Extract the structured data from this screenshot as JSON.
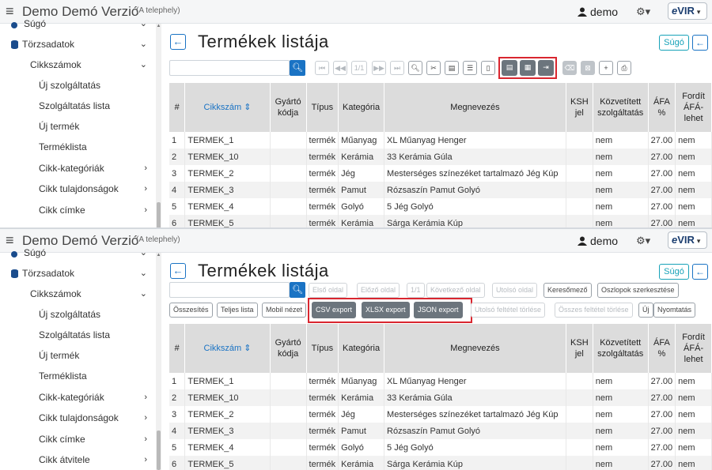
{
  "app": {
    "title": "Demo Demó Verzió",
    "site_note": "(A telephely)",
    "user": "demo",
    "logo": "VIR",
    "menu_icon": "hamburger-icon",
    "gear_icon": "gear-icon"
  },
  "sidebar": {
    "partial_item": "Súgó",
    "section": "Törzsadatok",
    "group": "Cikkszámok",
    "items": [
      "Új szolgáltatás",
      "Szolgáltatás lista",
      "Új termék",
      "Terméklista"
    ],
    "submenus": [
      "Cikk-kategóriák",
      "Cikk tulajdonságok",
      "Cikk címke",
      "Cikk átvitele"
    ]
  },
  "page": {
    "title": "Termékek listája",
    "help": "Súgó"
  },
  "toolbar_labels": {
    "page_indicator": "1/1",
    "first": "Első oldal",
    "prev": "Előző oldal",
    "next": "Következő oldal",
    "last": "Utolsó oldal",
    "search_field": "Keresőmező",
    "edit_columns": "Oszlopok szerkesztése",
    "summary": "Összesítés",
    "full_list": "Teljes lista",
    "mobile_view": "Mobil nézet",
    "csv_export": "CSV export",
    "xlsx_export": "XLSX export",
    "json_export": "JSON export",
    "clear_last_filter": "Utolsó feltétel törlése",
    "clear_all_filters": "Összes feltétel törlése",
    "new": "Új",
    "print": "Nyomtatás"
  },
  "table": {
    "headers": {
      "num": "#",
      "sku": "Cikkszám",
      "mfr_code_1": "Gyártó",
      "mfr_code_2": "kódja",
      "type": "Típus",
      "category": "Kategória",
      "name": "Megnevezés",
      "ksh_1": "KSH",
      "ksh_2": "jel",
      "mediated_1": "Közvetített",
      "mediated_2": "szolgáltatás",
      "vat_1": "ÁFA",
      "vat_2": "%",
      "reverse_1": "Fordít",
      "reverse_2": "ÁFÁ-",
      "reverse_3": "lehet"
    },
    "rows": [
      {
        "n": "1",
        "sku": "TERMEK_1",
        "type": "termék",
        "cat": "Műanyag",
        "name": "XL Műanyag Henger",
        "mediated": "nem",
        "vat": "27.00",
        "rev": "nem"
      },
      {
        "n": "2",
        "sku": "TERMEK_10",
        "type": "termék",
        "cat": "Kerámia",
        "name": "33 Kerámia Gúla",
        "mediated": "nem",
        "vat": "27.00",
        "rev": "nem"
      },
      {
        "n": "3",
        "sku": "TERMEK_2",
        "type": "termék",
        "cat": "Jég",
        "name": "Mesterséges színezéket tartalmazó Jég Kúp",
        "mediated": "nem",
        "vat": "27.00",
        "rev": "nem"
      },
      {
        "n": "4",
        "sku": "TERMEK_3",
        "type": "termék",
        "cat": "Pamut",
        "name": "Rózsaszín Pamut Golyó",
        "mediated": "nem",
        "vat": "27.00",
        "rev": "nem"
      },
      {
        "n": "5",
        "sku": "TERMEK_4",
        "type": "termék",
        "cat": "Golyó",
        "name": "5 Jég Golyó",
        "mediated": "nem",
        "vat": "27.00",
        "rev": "nem"
      },
      {
        "n": "6",
        "sku": "TERMEK_5",
        "type": "termék",
        "cat": "Kerámia",
        "name": "Sárga Kerámia Kúp",
        "mediated": "nem",
        "vat": "27.00",
        "rev": "nem"
      }
    ]
  }
}
